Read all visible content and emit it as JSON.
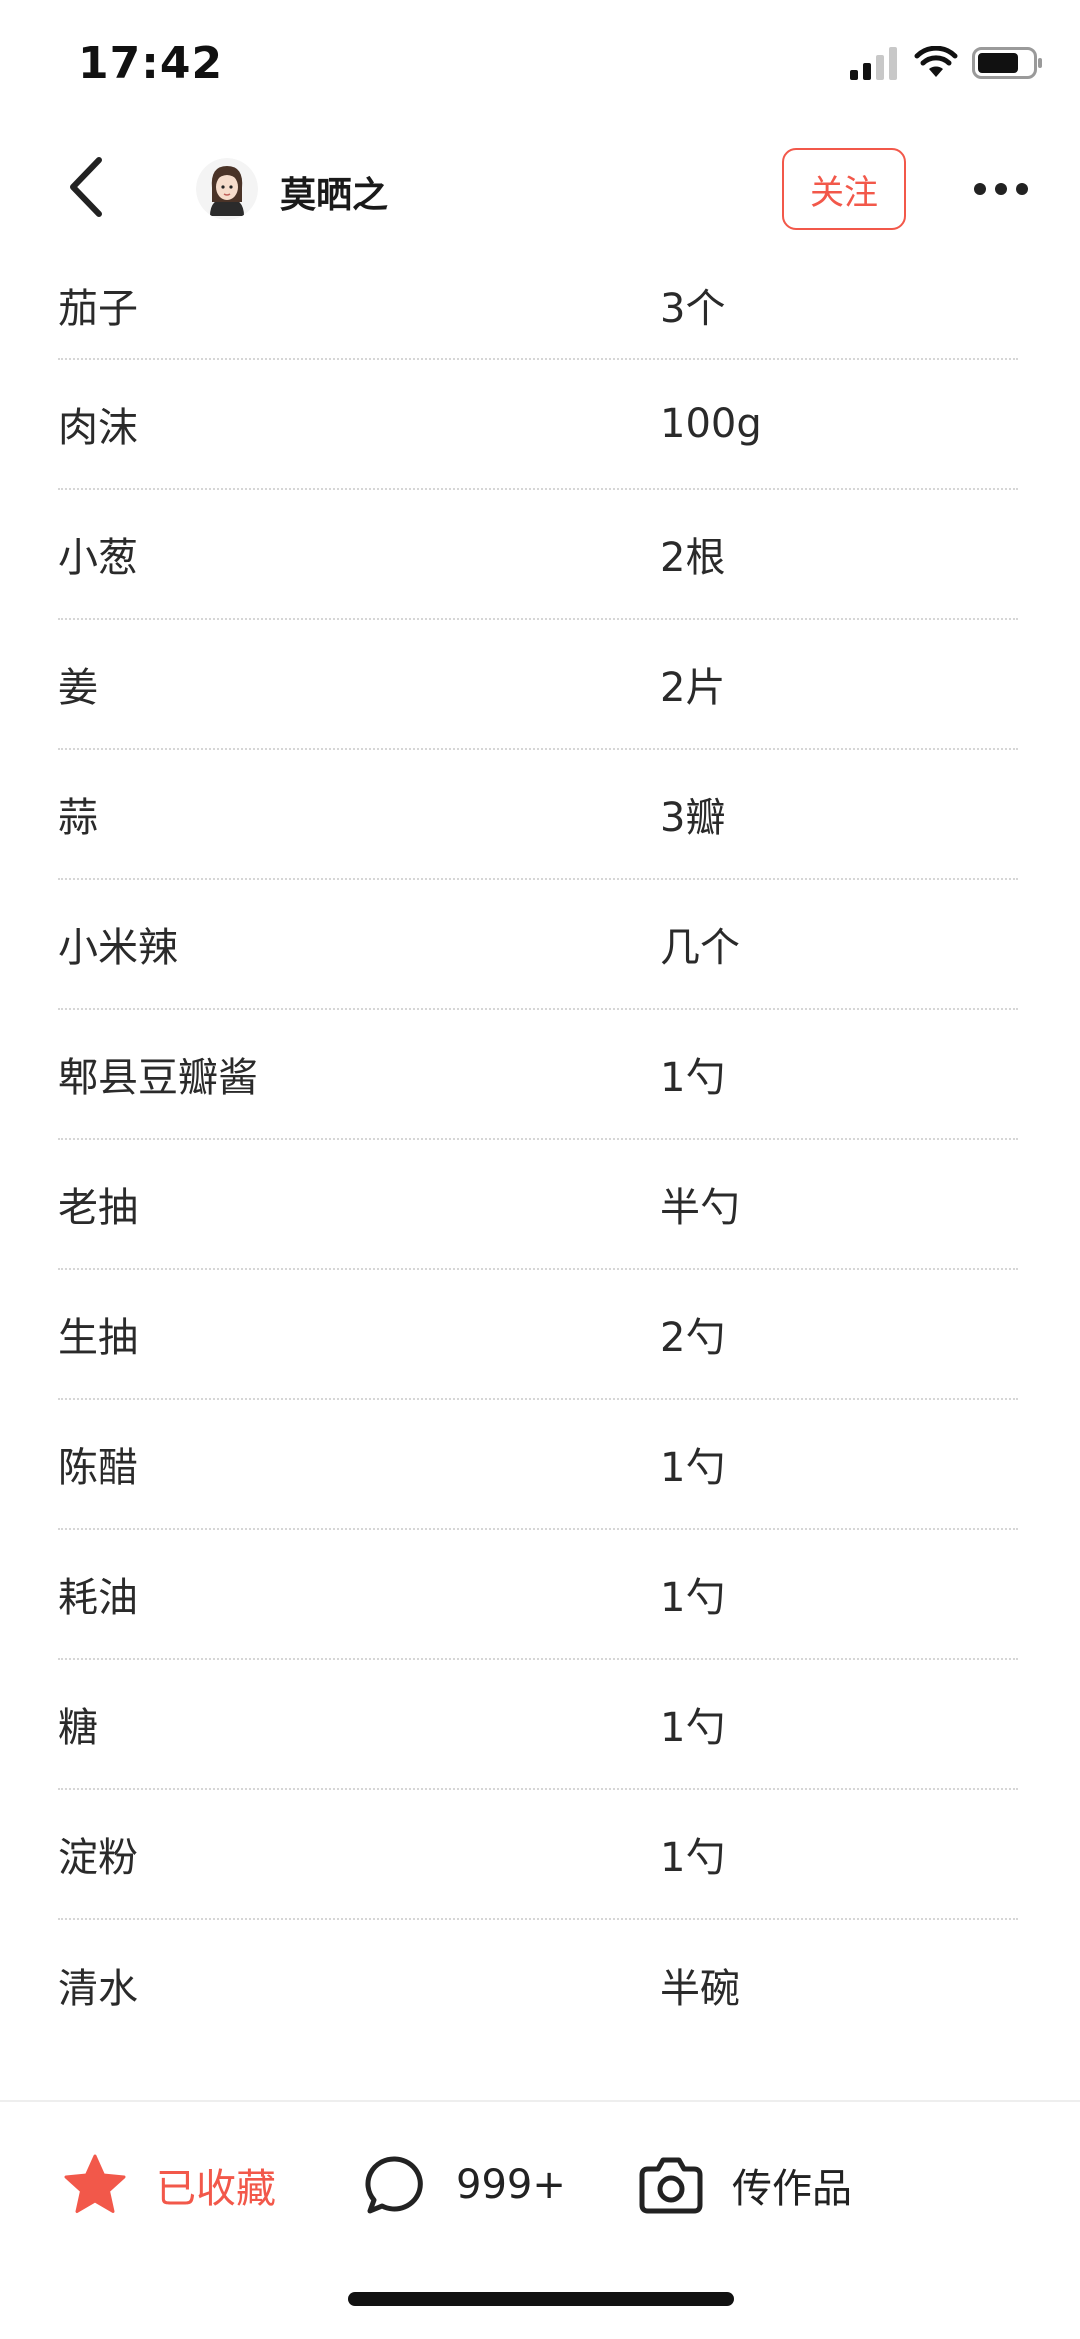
{
  "status_bar": {
    "time": "17:42"
  },
  "header": {
    "author_name": "莫晒之",
    "follow_label": "关注"
  },
  "ingredients": [
    {
      "name": "茄子",
      "amount": "3个"
    },
    {
      "name": "肉沫",
      "amount": "100g"
    },
    {
      "name": "小葱",
      "amount": "2根"
    },
    {
      "name": "姜",
      "amount": "2片"
    },
    {
      "name": "蒜",
      "amount": "3瓣"
    },
    {
      "name": "小米辣",
      "amount": "几个"
    },
    {
      "name": "郫县豆瓣酱",
      "amount": "1勺"
    },
    {
      "name": "老抽",
      "amount": "半勺"
    },
    {
      "name": "生抽",
      "amount": "2勺"
    },
    {
      "name": "陈醋",
      "amount": "1勺"
    },
    {
      "name": "耗油",
      "amount": "1勺"
    },
    {
      "name": "糖",
      "amount": "1勺"
    },
    {
      "name": "淀粉",
      "amount": "1勺"
    },
    {
      "name": "清水",
      "amount": "半碗"
    }
  ],
  "bottom_bar": {
    "favorite_label": "已收藏",
    "comment_count": "999+",
    "upload_label": "传作品"
  },
  "colors": {
    "accent": "#f2584a",
    "divider": "#d6d6d6",
    "text": "#2a2a2a"
  },
  "icons": {
    "back": "chevron-left-icon",
    "more": "more-dots-icon",
    "favorite": "star-icon",
    "comment": "comment-bubble-icon",
    "upload": "camera-icon",
    "signal": "signal-icon",
    "wifi": "wifi-icon",
    "battery": "battery-icon"
  }
}
